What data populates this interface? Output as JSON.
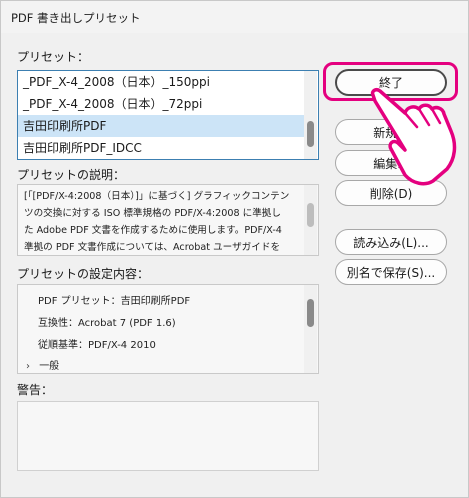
{
  "window": {
    "title": "PDF 書き出しプリセット"
  },
  "presets": {
    "label": "プリセット：",
    "items": [
      {
        "label": "_PDF_X-4_2008（日本）_150ppi",
        "selected": false
      },
      {
        "label": "_PDF_X-4_2008（日本）_72ppi",
        "selected": false
      },
      {
        "label": "吉田印刷所PDF",
        "selected": true
      },
      {
        "label": "吉田印刷所PDF_IDCC",
        "selected": false
      }
    ]
  },
  "description": {
    "label": "プリセットの説明：",
    "lines": [
      "[「[PDF/X-4:2008（日本）]」に基づく] グラフィックコンテン",
      "ツの交換に対する ISO 標準規格の PDF/X-4:2008 に準拠し",
      "た Adobe PDF 文書を作成するために使用します。PDF/X-4",
      "準拠の PDF 文書作成については、Acrobat ユーザガイドを"
    ]
  },
  "settings": {
    "label": "プリセットの設定内容：",
    "lines": [
      "PDF プリセット：吉田印刷所PDF",
      "互換性：Acrobat 7 (PDF 1.6)",
      "従順基準：PDF/X-4 2010"
    ],
    "group": "一般"
  },
  "warning": {
    "label": "警告："
  },
  "buttons": {
    "done": "終了",
    "new": "新規...",
    "edit": "編集...",
    "delete": "削除(D)",
    "load": "読み込み(L)...",
    "save_as": "別名で保存(S)..."
  },
  "colors": {
    "highlight": "#e4007f",
    "selection": "#cce4f7",
    "list_border": "#3c7fb1"
  }
}
